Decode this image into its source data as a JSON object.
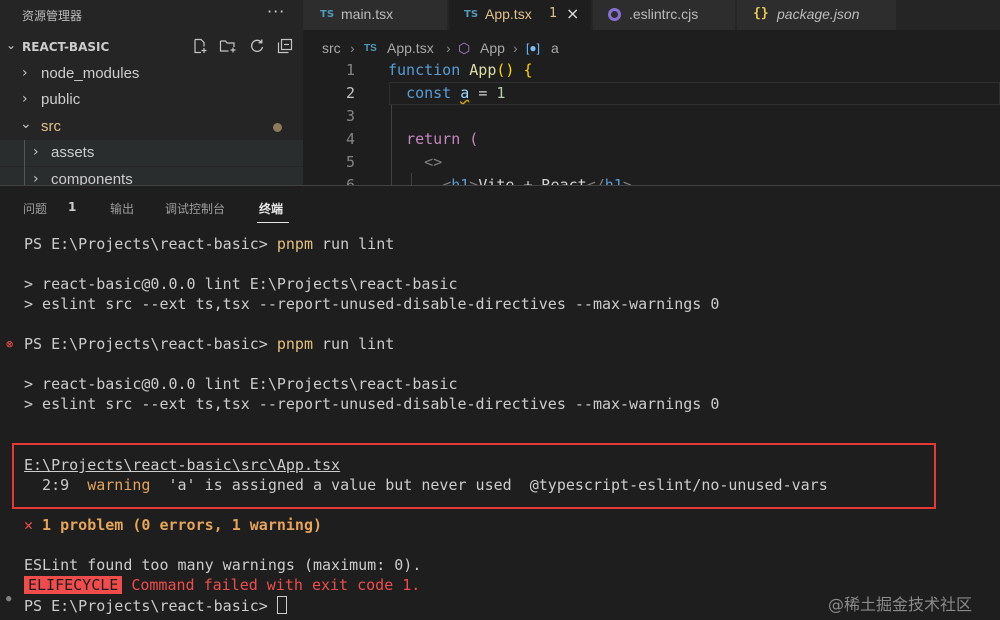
{
  "explorer": {
    "title": "资源管理器",
    "more": "···",
    "project": "REACT-BASIC",
    "tree": [
      {
        "label": "node_modules",
        "expanded": false
      },
      {
        "label": "public",
        "expanded": false
      },
      {
        "label": "src",
        "expanded": true
      },
      {
        "label": "assets",
        "expanded": false
      },
      {
        "label": "components",
        "expanded": false
      }
    ]
  },
  "tabs": [
    {
      "badge": "TS",
      "label": "main.tsx"
    },
    {
      "badge": "TS",
      "label": "App.tsx",
      "count": "1",
      "close": "×"
    },
    {
      "label": ".eslintrc.cjs"
    },
    {
      "badge": "{}",
      "label": "package.json"
    }
  ],
  "breadcrumb": {
    "src": "src",
    "file_badge": "TS",
    "file": "App.tsx",
    "component": "App",
    "variable": "a"
  },
  "code": {
    "lines": [
      {
        "n": "1"
      },
      {
        "n": "2"
      },
      {
        "n": "3"
      },
      {
        "n": "4"
      },
      {
        "n": "5"
      },
      {
        "n": "6"
      }
    ]
  },
  "panel": {
    "tabs": [
      "问题",
      "输出",
      "调试控制台",
      "终端"
    ],
    "problems_count": "1",
    "active_tab": "终端"
  },
  "terminal": {
    "prompt": "PS E:\\Projects\\react-basic> ",
    "command": "pnpm",
    "command_rest": " run lint",
    "script_line": "> react-basic@0.0.0 lint E:\\Projects\\react-basic",
    "eslint_line": "> eslint src --ext ts,tsx --report-unused-disable-directives --max-warnings 0",
    "file_path": "E:\\Projects\\react-basic\\src\\App.tsx",
    "warn_pos": "  2:9  ",
    "warn_word": "warning",
    "warn_msg": "  'a' is assigned a value but never used  @typescript-eslint/no-unused-vars",
    "problem_mark": "✕",
    "problem_summary": " 1 problem (0 errors, 1 warning)",
    "max_warn_line": "ESLint found too many warnings (maximum: 0).",
    "elifecycle": "ELIFECYCLE",
    "fail_msg": " Command failed with exit code 1."
  },
  "watermark": "@稀土掘金技术社区",
  "colors": {
    "highlight_box": "#e53935",
    "error": "#f14c4c",
    "warning": "#e5a45a"
  }
}
